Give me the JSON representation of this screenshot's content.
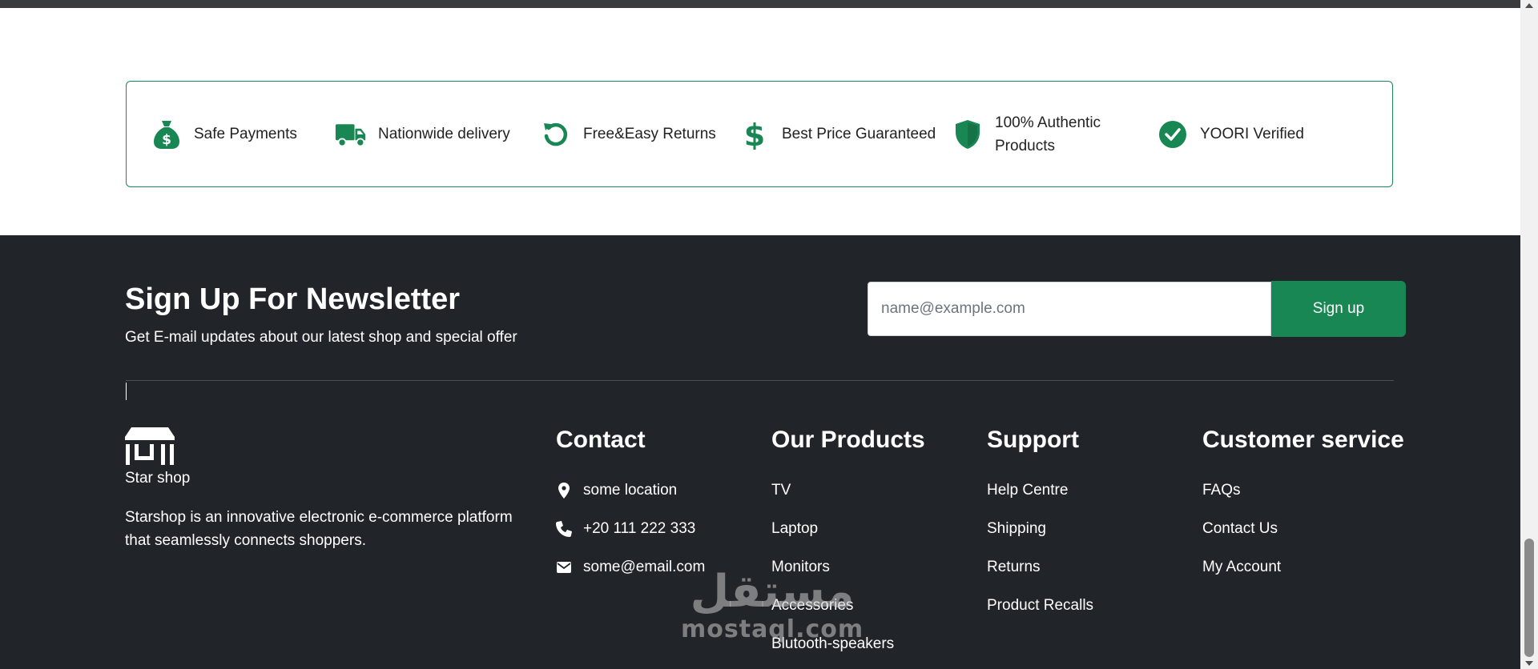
{
  "colors": {
    "accent": "#198754",
    "footer_bg": "#212529",
    "border": "#1c8a56"
  },
  "features": [
    {
      "icon": "money-bag-icon",
      "label": "Safe Payments"
    },
    {
      "icon": "truck-icon",
      "label": "Nationwide delivery"
    },
    {
      "icon": "rotate-icon",
      "label": "Free&Easy Returns"
    },
    {
      "icon": "dollar-icon",
      "label": "Best Price Guaranteed"
    },
    {
      "icon": "shield-icon",
      "label": "100% Authentic Products"
    },
    {
      "icon": "check-circle-icon",
      "label": "YOORI Verified"
    }
  ],
  "newsletter": {
    "title": "Sign Up For Newsletter",
    "subtitle": "Get E-mail updates about our latest shop and special offer",
    "placeholder": "name@example.com",
    "button_label": "Sign up"
  },
  "brand": {
    "logo_icon": "shop-icon",
    "name": "Star shop",
    "description": "Starshop is an innovative electronic e-commerce platform that seamlessly connects shoppers."
  },
  "contact": {
    "title": "Contact",
    "items": [
      {
        "icon": "location-pin-icon",
        "text": "some location"
      },
      {
        "icon": "phone-icon",
        "text": "+20 111 222 333"
      },
      {
        "icon": "envelope-icon",
        "text": "some@email.com"
      }
    ]
  },
  "products": {
    "title": "Our Products",
    "items": [
      "TV",
      "Laptop",
      "Monitors",
      "Accessories",
      "Blutooth-speakers"
    ]
  },
  "support": {
    "title": "Support",
    "items": [
      "Help Centre",
      "Shipping",
      "Returns",
      "Product Recalls"
    ]
  },
  "service": {
    "title": "Customer service",
    "items": [
      "FAQs",
      "Contact Us",
      "My Account"
    ]
  },
  "watermark": {
    "arabic": "مستقل",
    "latin": "mostaql.com"
  }
}
